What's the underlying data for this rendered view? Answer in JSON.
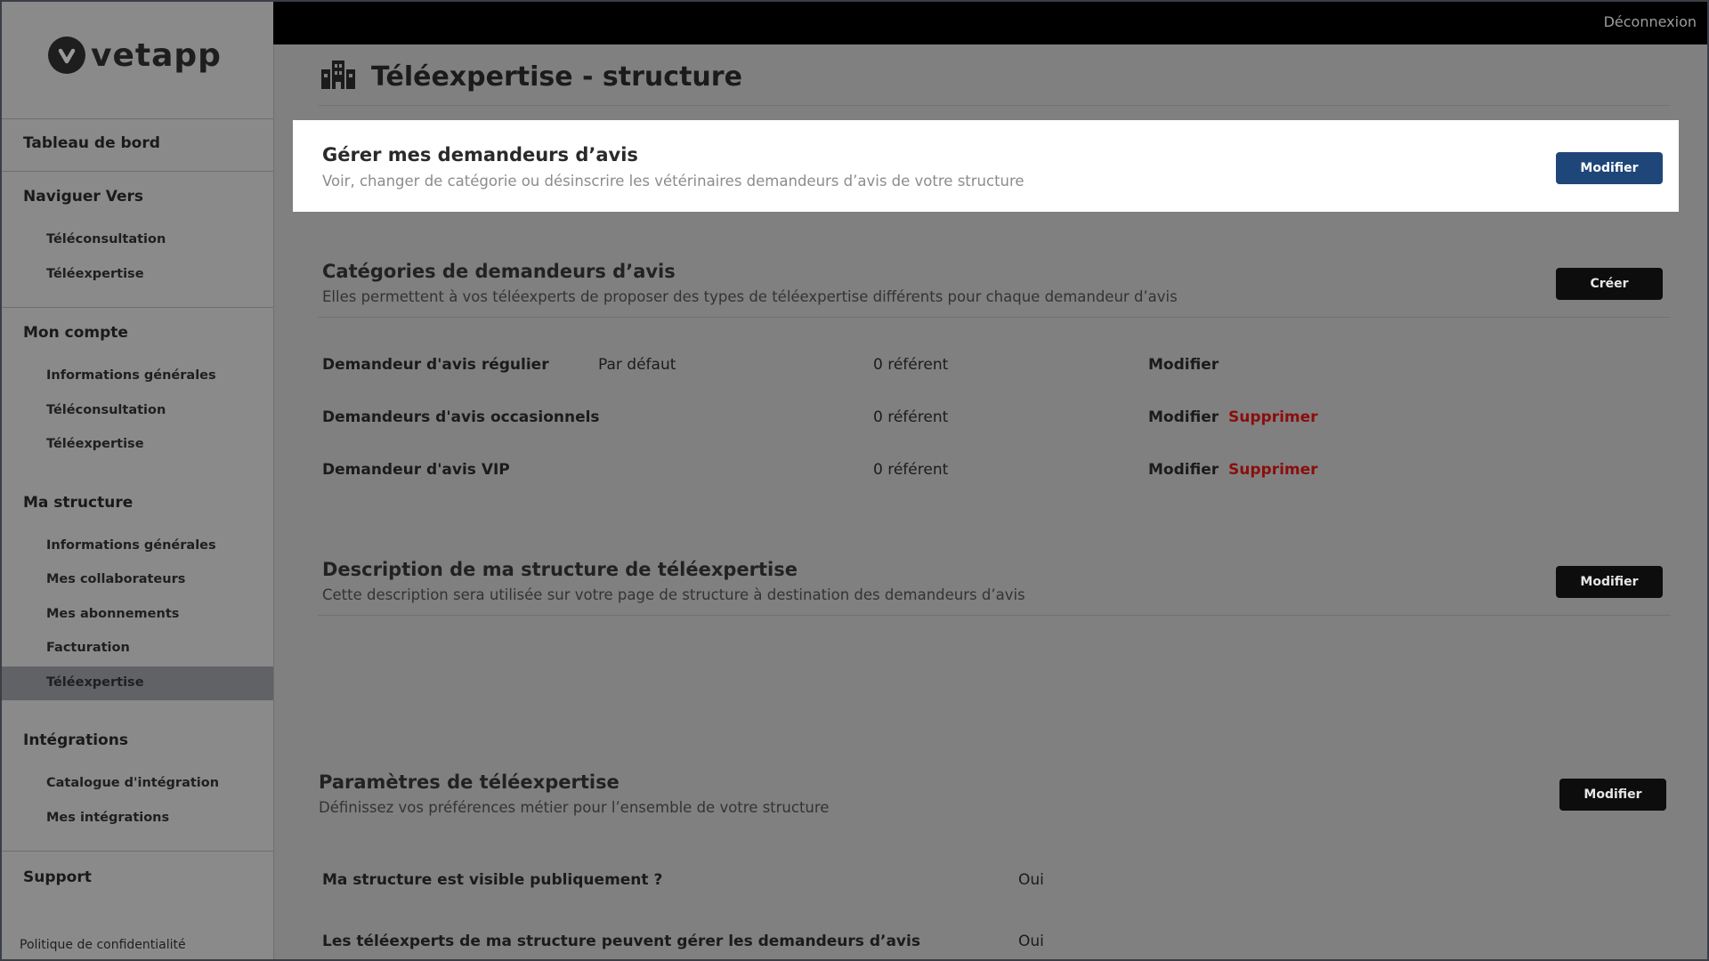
{
  "sidebar": {
    "logo_text": "vetapp",
    "sections": [
      {
        "title": "Tableau de bord",
        "items": []
      },
      {
        "title": "Naviguer Vers",
        "items": [
          "Téléconsultation",
          "Téléexpertise"
        ]
      },
      {
        "title": "Mon compte",
        "items": [
          "Informations générales",
          "Téléconsultation",
          "Téléexpertise"
        ]
      },
      {
        "title": "Ma structure",
        "items": [
          "Informations générales",
          "Mes collaborateurs",
          "Mes abonnements",
          "Facturation",
          "Téléexpertise"
        ]
      },
      {
        "title": "Intégrations",
        "items": [
          "Catalogue d'intégration",
          "Mes intégrations"
        ]
      },
      {
        "title": "Support",
        "items": []
      }
    ],
    "footer": "Politique de confidentialité"
  },
  "topbar": {
    "logout_label": "Déconnexion"
  },
  "page": {
    "title": "Téléexpertise - structure"
  },
  "manage": {
    "title": "Gérer mes demandeurs d’avis",
    "subtitle": "Voir, changer de catégorie ou désinscrire les vétérinaires demandeurs d’avis de votre structure",
    "button": "Modifier"
  },
  "categories": {
    "title": "Catégories de demandeurs d’avis",
    "subtitle": "Elles permettent à vos téléexperts de proposer des types de téléexpertise différents pour chaque demandeur d’avis",
    "button": "Créer",
    "rows": [
      {
        "name": "Demandeur d'avis régulier",
        "tag": "Par défaut",
        "count": "0 référent",
        "edit": "Modifier",
        "delete": ""
      },
      {
        "name": "Demandeurs d'avis occasionnels",
        "tag": "",
        "count": "0 référent",
        "edit": "Modifier",
        "delete": "Supprimer"
      },
      {
        "name": "Demandeur d'avis VIP",
        "tag": "",
        "count": "0 référent",
        "edit": "Modifier",
        "delete": "Supprimer"
      }
    ]
  },
  "description": {
    "title": "Description de ma structure de téléexpertise",
    "subtitle": "Cette description sera utilisée sur votre page de structure à destination des demandeurs d’avis",
    "button": "Modifier"
  },
  "settings": {
    "title": "Paramètres de téléexpertise",
    "subtitle": "Définissez vos préférences métier pour l’ensemble de votre structure",
    "button": "Modifier",
    "rows": [
      {
        "label": "Ma structure est visible publiquement ?",
        "value": "Oui"
      },
      {
        "label": "Les téléexperts de ma structure peuvent gérer les demandeurs d’avis",
        "value": "Oui"
      }
    ]
  },
  "icons": {
    "logo": "check-logo-icon",
    "page": "building-icon"
  }
}
